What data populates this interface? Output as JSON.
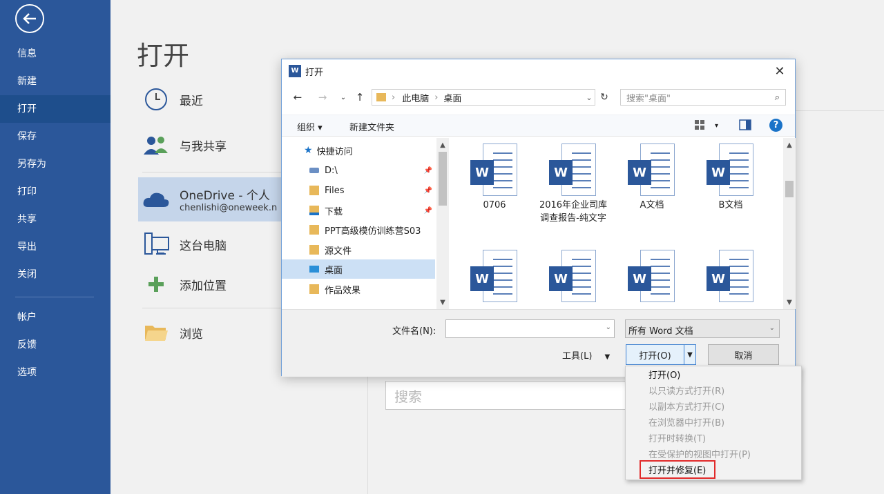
{
  "nav": {
    "items": [
      "信息",
      "新建",
      "打开",
      "保存",
      "另存为",
      "打印",
      "共享",
      "导出",
      "关闭",
      "帐户",
      "反馈",
      "选项"
    ],
    "active_index": 2
  },
  "main": {
    "title": "打开",
    "places": [
      {
        "label": "最近",
        "icon": "clock-icon"
      },
      {
        "label": "与我共享",
        "icon": "people-icon"
      },
      {
        "label": "OneDrive - 个人",
        "sub": "chenlishi@oneweek.n",
        "icon": "cloud-icon"
      },
      {
        "label": "这台电脑",
        "icon": "computer-icon"
      },
      {
        "label": "添加位置",
        "icon": "plus-icon"
      },
      {
        "label": "浏览",
        "icon": "folder-icon"
      }
    ],
    "search_placeholder": "搜索"
  },
  "dialog": {
    "title": "打开",
    "address": {
      "part1": "此电脑",
      "part2": "桌面"
    },
    "search_placeholder": "搜索\"桌面\"",
    "commands": {
      "organize": "组织",
      "new_folder": "新建文件夹"
    },
    "tree": [
      {
        "label": "快捷访问",
        "icon": "star-icon"
      },
      {
        "label": "D:\\",
        "icon": "drive-icon",
        "pinned": true
      },
      {
        "label": "Files",
        "icon": "folder-icon",
        "pinned": true
      },
      {
        "label": "下载",
        "icon": "download-folder-icon",
        "pinned": true
      },
      {
        "label": "PPT高级模仿训练营S03",
        "icon": "folder-icon"
      },
      {
        "label": "源文件",
        "icon": "folder-icon"
      },
      {
        "label": "桌面",
        "icon": "desktop-icon",
        "selected": true
      },
      {
        "label": "作品效果",
        "icon": "folder-icon"
      }
    ],
    "files": [
      {
        "name": "0706"
      },
      {
        "name": "2016年企业司库调查报告-纯文字"
      },
      {
        "name": "A文档"
      },
      {
        "name": "B文档"
      },
      {
        "name": ""
      },
      {
        "name": ""
      },
      {
        "name": ""
      },
      {
        "name": ""
      }
    ],
    "file_badge": "W",
    "filename_label": "文件名(N):",
    "filename_value": "",
    "filter_value": "所有 Word 文档",
    "tools_label": "工具(L)",
    "open_label": "打开(O)",
    "cancel_label": "取消"
  },
  "open_menu": [
    {
      "label": "打开(O)",
      "enabled": true
    },
    {
      "label": "以只读方式打开(R)",
      "enabled": false
    },
    {
      "label": "以副本方式打开(C)",
      "enabled": false
    },
    {
      "label": "在浏览器中打开(B)",
      "enabled": false
    },
    {
      "label": "打开时转换(T)",
      "enabled": false
    },
    {
      "label": "在受保护的视图中打开(P)",
      "enabled": false
    },
    {
      "label": "打开并修复(E)",
      "enabled": true,
      "highlighted": true
    }
  ],
  "colors": {
    "nav_bg": "#2b579a",
    "word_blue": "#2b579a",
    "highlight": "#e12a2a"
  }
}
